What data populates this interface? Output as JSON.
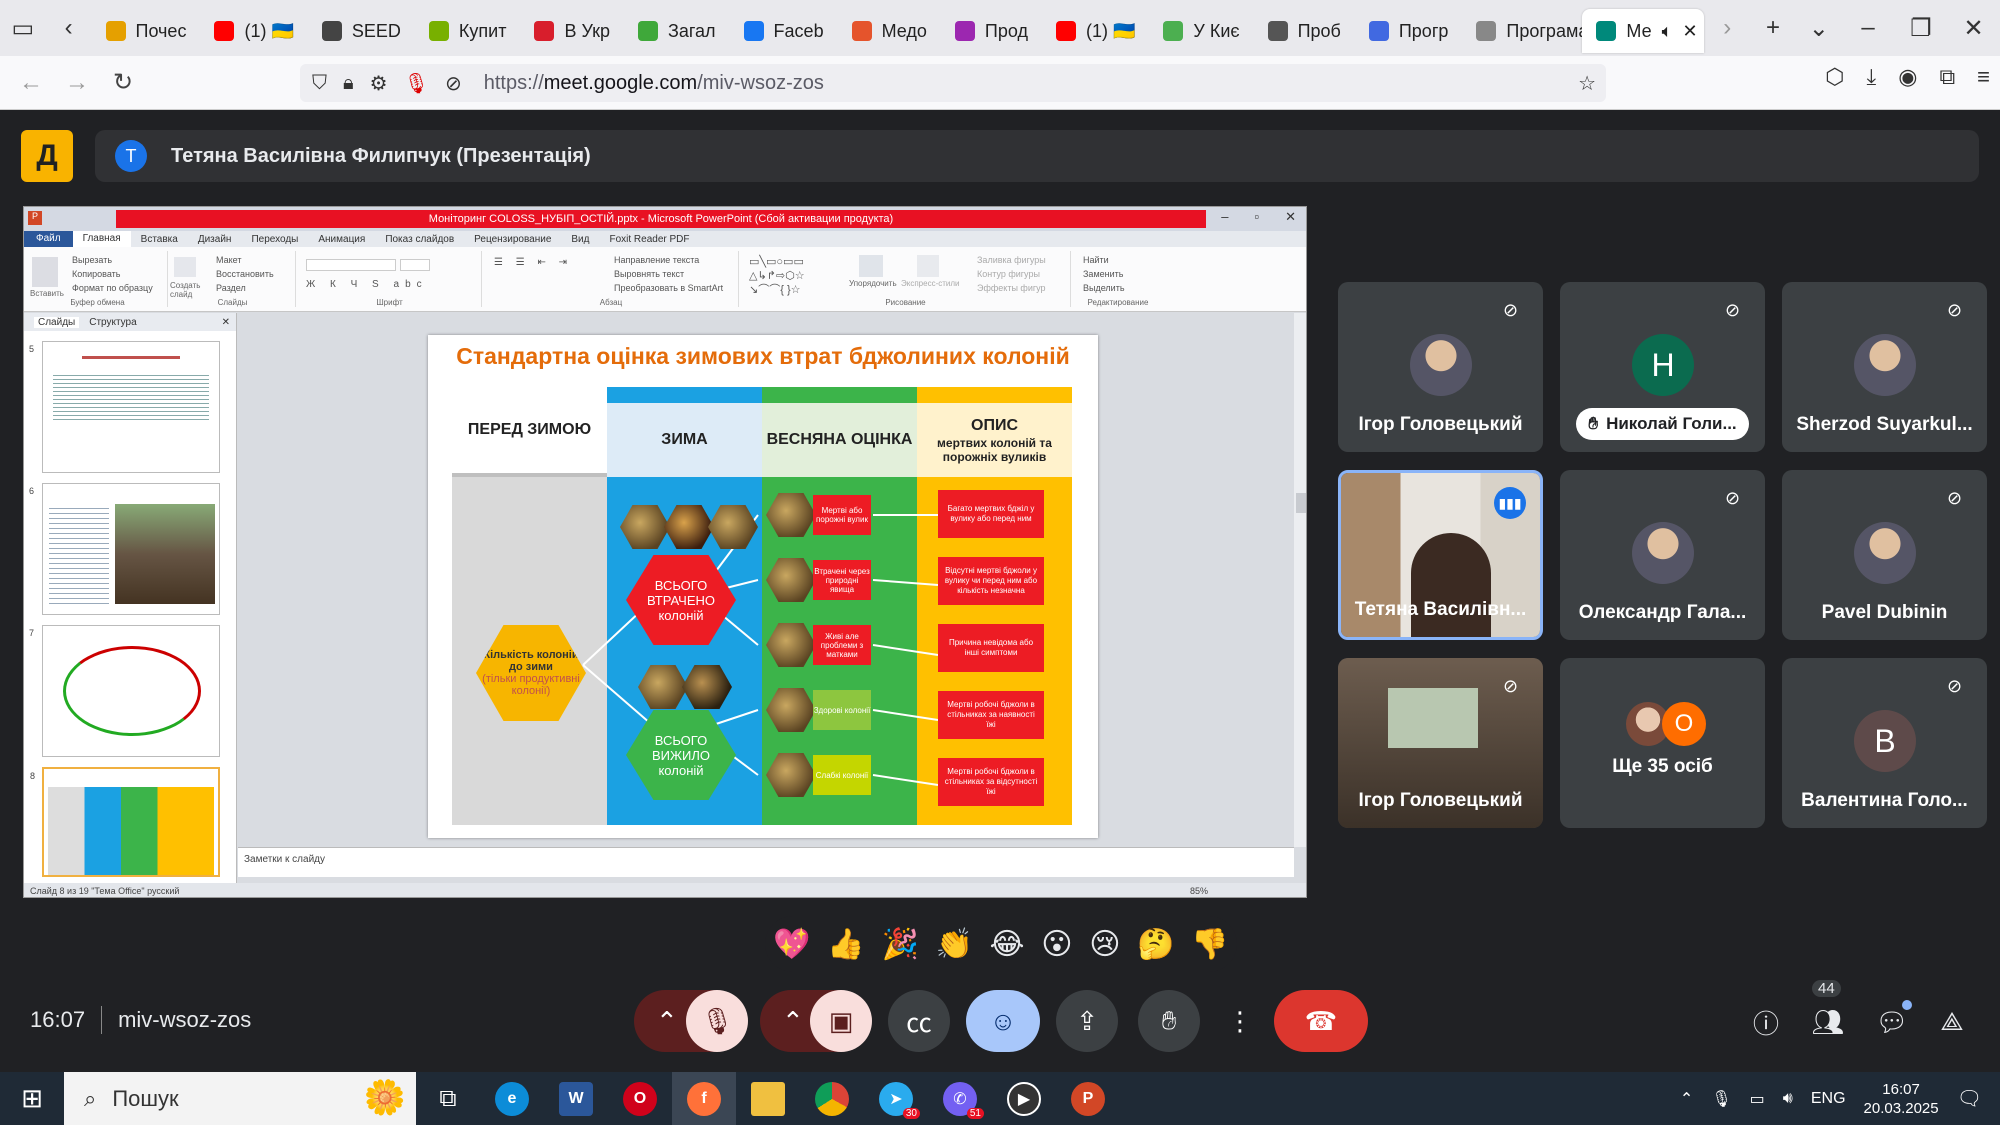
{
  "browser": {
    "tabs": [
      {
        "label": "Почес",
        "color": "#e5a000"
      },
      {
        "label": "(1) 🇺🇦",
        "color": "#ff0000"
      },
      {
        "label": "SEED",
        "color": "#444444"
      },
      {
        "label": "Купит",
        "color": "#78b000"
      },
      {
        "label": "В Укр",
        "color": "#d81e2c"
      },
      {
        "label": "Загал",
        "color": "#3fa83a"
      },
      {
        "label": "Faceb",
        "color": "#1877f2"
      },
      {
        "label": "Медо",
        "color": "#e5542c"
      },
      {
        "label": "Прод",
        "color": "#9c27b0"
      },
      {
        "label": "(1) 🇺🇦",
        "color": "#ff0000"
      },
      {
        "label": "У Киє",
        "color": "#4caf50"
      },
      {
        "label": "Проб",
        "color": "#555555"
      },
      {
        "label": "Прогр",
        "color": "#4169e1"
      },
      {
        "label": "Програма",
        "color": "#888888"
      },
      {
        "label": "Ме",
        "color": "#00897b",
        "active": true
      }
    ],
    "url_prefix": "https://",
    "url_host": "meet.google.com",
    "url_path": "/miv-wsoz-zos"
  },
  "meet": {
    "logo_letter": "Д",
    "presenter_initial": "T",
    "presenter_label": "Тетяна Василівна Филипчук (Презентація)",
    "time": "16:07",
    "code": "miv-wsoz-zos",
    "participant_count": "44",
    "reactions": [
      "💖",
      "👍",
      "🎉",
      "👏",
      "😂",
      "😮",
      "😢",
      "🤔",
      "👎"
    ]
  },
  "participants": [
    {
      "name": "Ігор Головецький",
      "type": "photo",
      "muted": true
    },
    {
      "name": "Николай Голи...",
      "type": "letter",
      "letter": "H",
      "color": "#0b6b4f",
      "muted": true,
      "pill": true
    },
    {
      "name": "Sherzod Suyarkul...",
      "type": "photo",
      "muted": true
    },
    {
      "name": "Тетяна Василівн...",
      "type": "video",
      "speaking": true
    },
    {
      "name": "Олександр Гала...",
      "type": "photo",
      "muted": true
    },
    {
      "name": "Pavel Dubinin",
      "type": "photo",
      "muted": true
    },
    {
      "name": "Ігор Головецький",
      "type": "video2",
      "muted": true
    },
    {
      "name": "Ще 35 осіб",
      "type": "more",
      "letter": "O"
    },
    {
      "name": "Валентина Голо...",
      "type": "letter",
      "letter": "B",
      "color": "#5e4a4a",
      "muted": true
    }
  ],
  "powerpoint": {
    "title": "Моніторинг COLOSS_НУБІП_ОСТІЙ.pptx - Microsoft PowerPoint (Сбой активации продукта)",
    "tabs": [
      "Файл",
      "Главная",
      "Вставка",
      "Дизайн",
      "Переходы",
      "Анимация",
      "Показ слайдов",
      "Рецензирование",
      "Вид",
      "Foxit Reader PDF"
    ],
    "ribbon_groups": [
      "Буфер обмена",
      "Слайды",
      "Шрифт",
      "Абзац",
      "Рисование",
      "Редактирование"
    ],
    "clipboard": [
      "Вырезать",
      "Копировать",
      "Формат по образцу"
    ],
    "slides_group": [
      "Макет",
      "Восстановить",
      "Раздел"
    ],
    "paste_label": "Вставить",
    "create_slide_label": "Создать слайд",
    "drawing": [
      "Упорядочить",
      "Экспресс-стили",
      "Заливка фигуры",
      "Контур фигуры",
      "Эффекты фигур"
    ],
    "editing": [
      "Найти",
      "Заменить",
      "Выделить"
    ],
    "paragraph": [
      "Направление текста",
      "Выровнять текст",
      "Преобразовать в SmartArt"
    ],
    "panel_tabs": [
      "Слайды",
      "Структура"
    ],
    "slide_numbers": [
      "5",
      "6",
      "7",
      "8"
    ],
    "notes": "Заметки к слайду",
    "status": "Слайд 8 из 19   \"Тема Office\"   русский",
    "zoom": "85%"
  },
  "slide": {
    "title": "Стандартна оцінка зимових втрат бджолиних колоній",
    "col_headers": [
      "ПЕРЕД ЗИМОЮ",
      "ЗИМА",
      "ВЕСНЯНА ОЦІНКА",
      "ОПИС"
    ],
    "col4_sub": "мертвих колоній та порожніх вуликів",
    "start_hex": "Кількість колоній до зими",
    "start_sub": "(тільки продуктивні колонії)",
    "lost": "ВСЬОГО ВТРАЧЕНО колоній",
    "survived": "ВСЬОГО ВИЖИЛО колоній",
    "spring": [
      "Мертві або порожні вулик",
      "Втрачені через природні явища",
      "Живі але проблеми з матками",
      "Здорові колонії",
      "Слабкі колонії"
    ],
    "desc": [
      "Багато мертвих бджіл у вулику або перед ним",
      "Відсутні мертві бджоли у вулику чи перед ним або кількість незначна",
      "Причина невідома або інші симптоми",
      "Мертві робочі бджоли в стільниках за наявності їжі",
      "Мертві робочі бджоли в стільниках за відсутності їжі"
    ]
  },
  "taskbar": {
    "search": "Пошук",
    "lang": "ENG",
    "time": "16:07",
    "date": "20.03.2025",
    "badges": {
      "telegram": "30",
      "viber": "51"
    }
  }
}
